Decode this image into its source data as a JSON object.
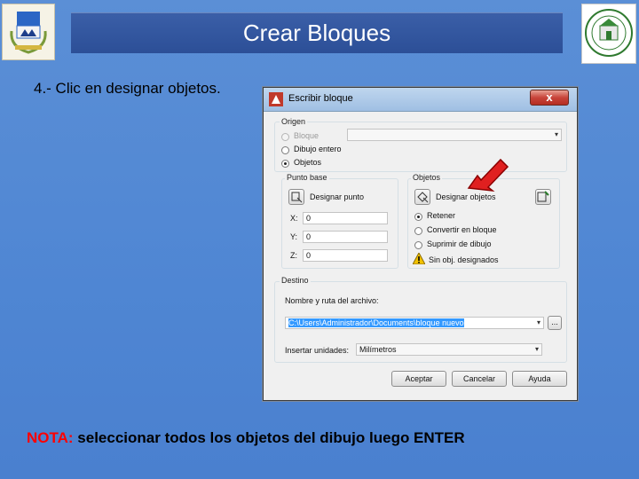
{
  "slide": {
    "title": "Crear Bloques",
    "step_text": "4.- Clic en designar objetos.",
    "note_label": "NOTA:",
    "note_text": " seleccionar todos los objetos del dibujo luego ENTER"
  },
  "dialog": {
    "title": "Escribir bloque",
    "close_label": "x",
    "origen": {
      "legend": "Origen",
      "options": [
        "Bloque",
        "Dibujo entero",
        "Objetos"
      ],
      "selected": "Objetos"
    },
    "punto_base": {
      "legend": "Punto base",
      "pick_button": "Designar punto",
      "x_label": "X:",
      "x_value": "0",
      "y_label": "Y:",
      "y_value": "0",
      "z_label": "Z:",
      "z_value": "0"
    },
    "objetos": {
      "legend": "Objetos",
      "select_button": "Designar objetos",
      "options": [
        "Retener",
        "Convertir en bloque",
        "Suprimir de dibujo"
      ],
      "selected": "Retener",
      "warning": "Sin obj. designados"
    },
    "destino": {
      "legend": "Destino",
      "path_label": "Nombre y ruta del archivo:",
      "path_value": "C:\\Users\\Administrador\\Documents\\bloque nuevo",
      "browse_label": "...",
      "units_label": "Insertar unidades:",
      "units_value": "Milímetros"
    },
    "buttons": {
      "ok": "Aceptar",
      "cancel": "Cancelar",
      "help": "Ayuda"
    }
  },
  "colors": {
    "accent_arrow": "#e02020",
    "title_bar": "#2c4f97",
    "note_label": "#ff0000"
  }
}
